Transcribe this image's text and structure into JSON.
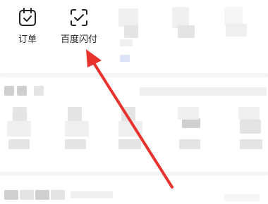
{
  "toolbar": {
    "items": [
      {
        "label": "订单",
        "icon": "calendar-check-icon"
      },
      {
        "label": "百度闪付",
        "icon": "scan-check-icon"
      }
    ]
  },
  "annotation": {
    "color": "#e8322d"
  }
}
